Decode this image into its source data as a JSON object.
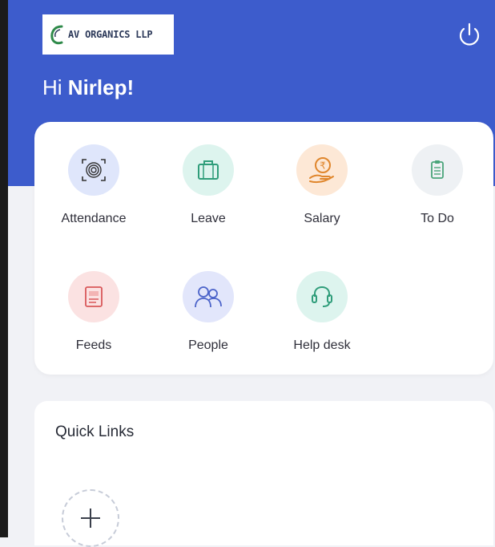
{
  "brand": {
    "logo_text": "AV ORGANICS LLP",
    "primary_color": "#3d5ccc"
  },
  "header": {
    "greeting_prefix": "Hi",
    "user_name": "Nirlep!",
    "power_icon": "power-icon"
  },
  "modules": [
    {
      "label": "Attendance",
      "icon": "fingerprint-icon",
      "color": "#dfe6fb"
    },
    {
      "label": "Leave",
      "icon": "briefcase-icon",
      "color": "#ddf4ee"
    },
    {
      "label": "Salary",
      "icon": "salary-hand-rupee-icon",
      "color": "#fde8d6"
    },
    {
      "label": "To Do",
      "icon": "clipboard-icon",
      "color": "#eef1f4"
    },
    {
      "label": "Feeds",
      "icon": "feeds-icon",
      "color": "#fbe2e2"
    },
    {
      "label": "People",
      "icon": "people-icon",
      "color": "#e2e6fb"
    },
    {
      "label": "Help desk",
      "icon": "headset-icon",
      "color": "#ddf4ee"
    }
  ],
  "quick_links": {
    "title": "Quick Links",
    "add_icon": "add-icon"
  }
}
